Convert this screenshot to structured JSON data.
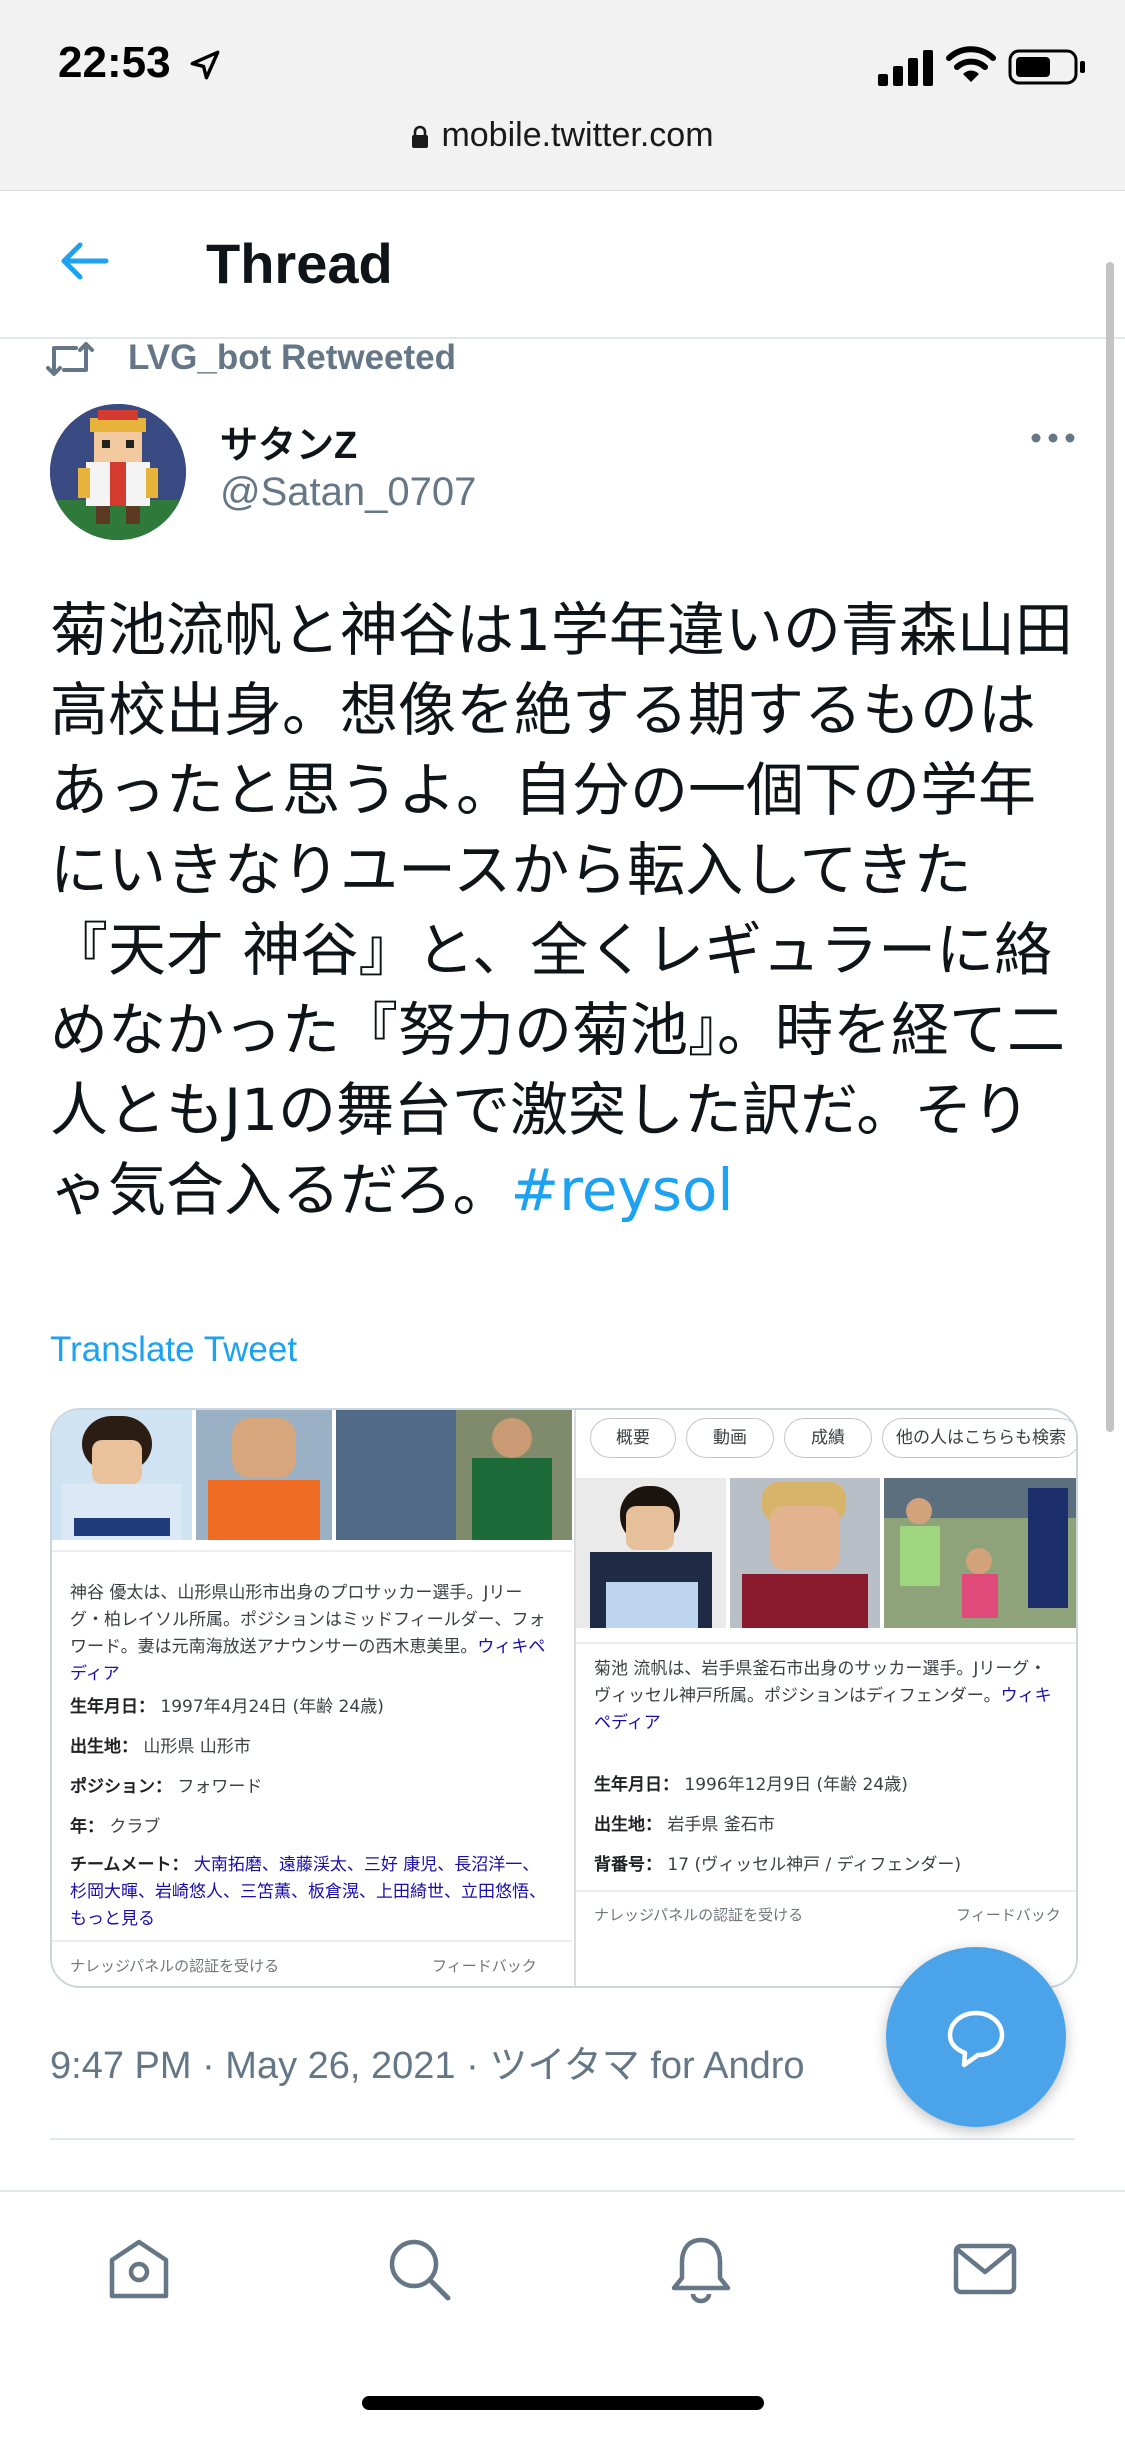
{
  "status_bar": {
    "time": "22:53"
  },
  "browser": {
    "url": "mobile.twitter.com"
  },
  "header": {
    "title": "Thread"
  },
  "retweet": {
    "label": "LVG_bot Retweeted"
  },
  "tweet": {
    "author_name": "サタンZ",
    "author_handle": "@Satan_0707",
    "text": "菊池流帆と神谷は1学年違いの青森山田高校出身。想像を絶する期するものはあったと思うよ。自分の一個下の学年にいきなりユースから転入してきた『天才 神谷』と、全くレギュラーに絡めなかった『努力の菊池』。時を経て二人ともJ1の舞台で激突した訳だ。そりゃ気合入るだろ。",
    "hashtag": "#reysol",
    "translate_label": "Translate Tweet",
    "timestamp": "9:47 PM · May 26, 2021 · ツイタマ for Andro"
  },
  "media": {
    "left_panel": {
      "description": "神谷 優太は、山形県山形市出身のプロサッカー選手。Jリーグ・柏レイソル所属。ポジションはミッドフィールダー、フォワード。妻は元南海放送アナウンサーの西木恵美里。",
      "wiki_link": "ウィキペディア",
      "facts": [
        {
          "key": "生年月日",
          "value": "1997年4月24日 (年齢 24歳)"
        },
        {
          "key": "出生地",
          "value": "山形県 山形市"
        },
        {
          "key": "ポジション",
          "value": "フォワード"
        },
        {
          "key": "年",
          "value": "クラブ"
        }
      ],
      "teammates_label": "チームメート",
      "teammates": "大南拓磨、遠藤渓太、三好 康児、長沼洋一、杉岡大暉、岩崎悠人、三笘薫、板倉滉、上田綺世、立田悠悟、もっと見る",
      "footer_left": "ナレッジパネルの認証を受ける",
      "footer_right": "フィードバック"
    },
    "right_panel": {
      "chips": [
        "概要",
        "動画",
        "成績",
        "他の人はこちらも検索"
      ],
      "description": "菊池 流帆は、岩手県釜石市出身のサッカー選手。Jリーグ・ヴィッセル神戸所属。ポジションはディフェンダー。",
      "wiki_link": "ウィキペディア",
      "facts": [
        {
          "key": "生年月日",
          "value": "1996年12月9日 (年齢 24歳)"
        },
        {
          "key": "出生地",
          "value": "岩手県 釜石市"
        },
        {
          "key": "背番号",
          "value": "17 (ヴィッセル神戸 / ディフェンダー)"
        }
      ],
      "footer_left": "ナレッジパネルの認証を受ける",
      "footer_right": "フィードバック"
    }
  },
  "colors": {
    "accent": "#1da1f2",
    "fab": "#4ba3ea",
    "secondary_text": "#657786",
    "divider": "#e1e8ed"
  },
  "icons": {
    "nav": [
      "home-icon",
      "search-icon",
      "bell-icon",
      "mail-icon"
    ],
    "fab": "compose-reply-icon"
  }
}
